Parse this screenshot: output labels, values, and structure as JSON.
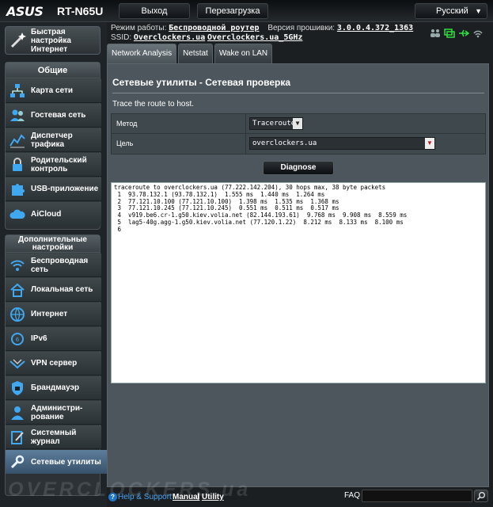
{
  "header": {
    "brand": "ASUS",
    "model": "RT-N65U",
    "logout_label": "Выход",
    "reboot_label": "Перезагрузка",
    "language": "Русский"
  },
  "info": {
    "mode_label": "Режим работы:",
    "mode_value": "Беспроводной роутер",
    "firmware_label": "Версия прошивки:",
    "firmware_value": "3.0.0.4.372_1363",
    "ssid_label": "SSID:",
    "ssid_1": "Overclockers.ua",
    "ssid_2": "Overclockers.ua_5GHz"
  },
  "sidebar": {
    "quick_setup": "Быстрая настройка Интернет",
    "general_title": "Общие",
    "general_items": [
      "Карта сети",
      "Гостевая сеть",
      "Диспетчер трафика",
      "Родительский контроль",
      "USB-приложение",
      "AiCloud"
    ],
    "advanced_title": "Дополнительные настройки",
    "advanced_items": [
      "Беспроводная сеть",
      "Локальная сеть",
      "Интернет",
      "IPv6",
      "VPN сервер",
      "Брандмауэр",
      "Администри-рование",
      "Системный журнал",
      "Сетевые утилиты"
    ]
  },
  "tabs": [
    "Network Analysis",
    "Netstat",
    "Wake on LAN"
  ],
  "panel": {
    "title": "Сетевые утилиты - Сетевая проверка",
    "description": "Trace the route to host.",
    "method_label": "Метод",
    "method_value": "Traceroute",
    "target_label": "Цель",
    "target_value": "overclockers.ua",
    "diagnose_label": "Diagnose",
    "output": "traceroute to overclockers.ua (77.222.142.204), 30 hops max, 38 byte packets\n 1  93.78.132.1 (93.78.132.1)  1.555 ms  1.440 ms  1.264 ms\n 2  77.121.10.100 (77.121.10.100)  1.398 ms  1.535 ms  1.368 ms\n 3  77.121.10.245 (77.121.10.245)  0.551 ms  0.511 ms  0.517 ms\n 4  v919.be6.cr-1.g50.kiev.volia.net (82.144.193.61)  9.768 ms  9.908 ms  8.559 ms\n 5  lag5-40g.agg-1.g50.kiev.volia.net (77.120.1.22)  8.212 ms  8.133 ms  8.100 ms\n 6"
  },
  "footer": {
    "help_label": "Help & Support",
    "manual_label": "Manual",
    "separator": "|",
    "utility_label": "Utility",
    "faq_label": "FAQ"
  },
  "watermark": "OVERCLOCKERS.ua",
  "colors": {
    "accent_active": "#4b6882",
    "panel_bg": "#4c565c",
    "link_blue": "#4aa3ee",
    "dropdown_arrow_red": "#c0191f"
  }
}
